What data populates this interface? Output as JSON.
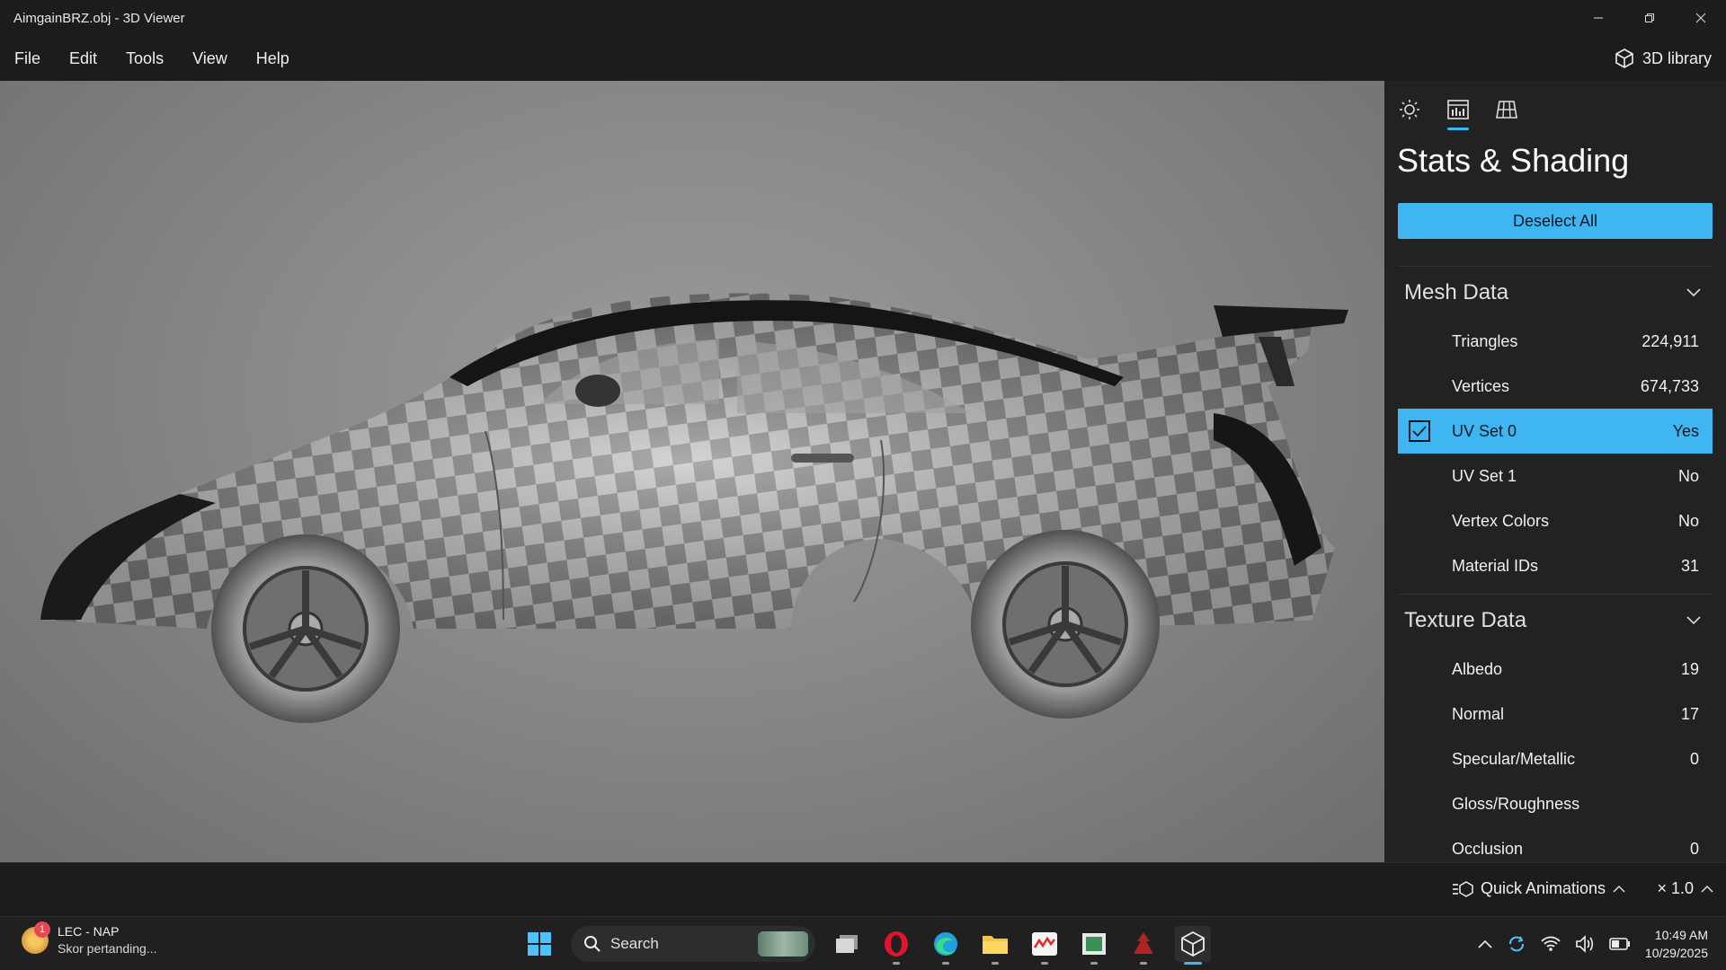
{
  "window": {
    "title": "AimgainBRZ.obj - 3D Viewer"
  },
  "menu": {
    "items": [
      "File",
      "Edit",
      "Tools",
      "View",
      "Help"
    ],
    "library_label": "3D library"
  },
  "panel": {
    "title": "Stats & Shading",
    "deselect_label": "Deselect All",
    "tabs": [
      "lighting-icon",
      "stats-icon",
      "grid-icon"
    ],
    "active_tab": "stats-icon",
    "mesh": {
      "header": "Mesh Data",
      "rows": [
        {
          "label": "Triangles",
          "value": "224,911"
        },
        {
          "label": "Vertices",
          "value": "674,733"
        },
        {
          "label": "UV Set 0",
          "value": "Yes",
          "selected": true
        },
        {
          "label": "UV Set 1",
          "value": "No"
        },
        {
          "label": "Vertex Colors",
          "value": "No"
        },
        {
          "label": "Material IDs",
          "value": "31"
        }
      ]
    },
    "texture": {
      "header": "Texture Data",
      "rows": [
        {
          "label": "Albedo",
          "value": "19"
        },
        {
          "label": "Normal",
          "value": "17"
        },
        {
          "label": "Specular/Metallic",
          "value": "0"
        },
        {
          "label": "Gloss/Roughness",
          "value": ""
        },
        {
          "label": "Occlusion",
          "value": "0"
        }
      ]
    }
  },
  "bottom": {
    "quick_animations": "Quick Animations",
    "speed": "× 1.0"
  },
  "taskbar": {
    "news_title": "LEC - NAP",
    "news_sub": "Skor pertanding...",
    "news_badge": "1",
    "search_placeholder": "Search",
    "time": "10:49 AM",
    "date": "10/29/2025"
  },
  "colors": {
    "accent": "#3fb6f2",
    "panel_bg": "#222222",
    "chrome_bg": "#1c1c1c"
  }
}
